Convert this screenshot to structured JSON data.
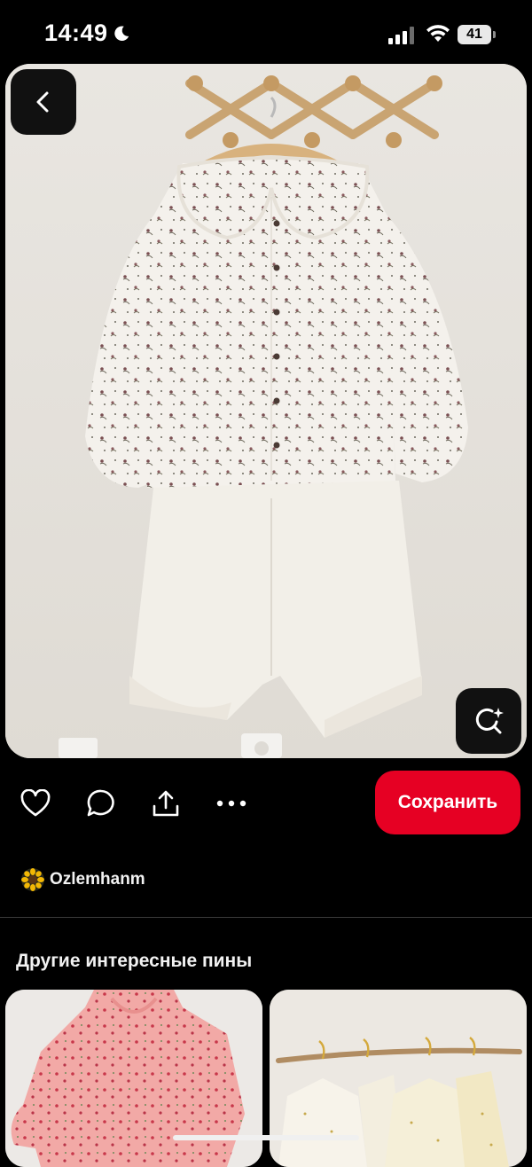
{
  "status_bar": {
    "time": "14:49",
    "battery": "41"
  },
  "pin": {
    "image_alt": "Floral print blouse with ruffled collar and white ruffled shorts on a wooden hanger",
    "back_icon": "chevron-left-icon",
    "visual_search_icon": "search-sparkle-icon"
  },
  "actions": {
    "like_icon": "heart-icon",
    "comment_icon": "chat-bubble-icon",
    "share_icon": "share-icon",
    "more_icon": "more-dots-icon",
    "save_label": "Сохранить"
  },
  "author": {
    "name": "Ozlemhanm",
    "avatar_icon": "sunflower-icon"
  },
  "related": {
    "title": "Другие интересные пины",
    "items": [
      {
        "alt": "Pink floral pajama shirt"
      },
      {
        "alt": "Floral pajama sets hanging on branch"
      }
    ]
  },
  "colors": {
    "save_button": "#e60023",
    "background": "#000000"
  }
}
